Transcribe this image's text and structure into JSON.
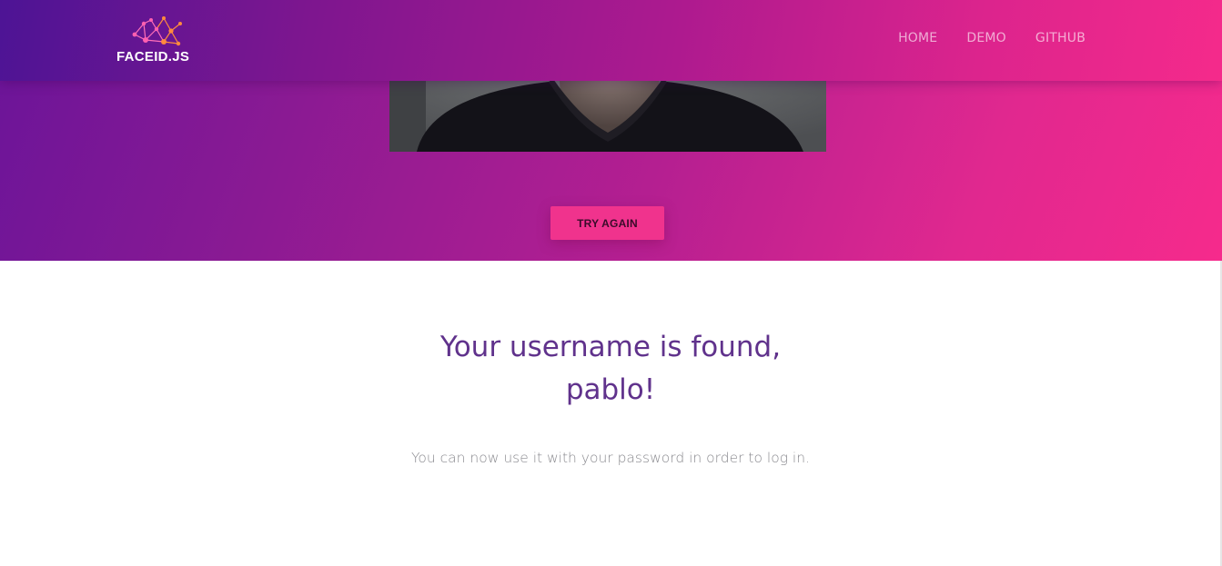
{
  "brand": {
    "name": "FACEID.JS",
    "icon": "network-nodes-logo-icon"
  },
  "nav": {
    "items": [
      {
        "label": "HOME"
      },
      {
        "label": "DEMO"
      },
      {
        "label": "GITHUB"
      }
    ]
  },
  "camera": {
    "icon": "webcam-feed"
  },
  "actions": {
    "try_again_label": "TRY AGAIN"
  },
  "result": {
    "heading_line1": "Your username is found,",
    "heading_line2": "pablo!",
    "message": "You can now use it with your password in order to log in."
  },
  "colors": {
    "gradient_start": "#6a1499",
    "gradient_end": "#f62a8c",
    "button": "#f0338d",
    "heading": "#60328c",
    "body_text": "#8a8a8f"
  }
}
